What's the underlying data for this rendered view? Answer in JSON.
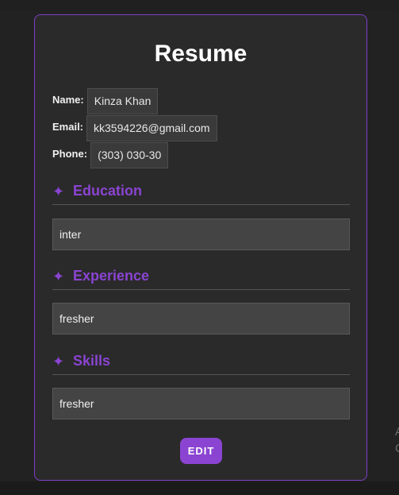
{
  "resume": {
    "title": "Resume",
    "name_label": "Name:",
    "name_value": "Kinza Khan",
    "email_label": "Email:",
    "email_value": "kk3594226@gmail.com",
    "phone_label": "Phone:",
    "phone_value": "(303) 030-30",
    "section_icon_glyph": "✦",
    "education_title": "Education",
    "education_value": "inter",
    "experience_title": "Experience",
    "experience_value": "fresher",
    "skills_title": "Skills",
    "skills_value": "fresher",
    "edit_label": "EDIT"
  },
  "edge": {
    "line1": "A",
    "line2": "C"
  },
  "colors": {
    "accent": "#8a44d1",
    "card_border": "#7d3fc6",
    "background": "#222222",
    "card_background": "#2a2a2a",
    "field_background": "#444444"
  },
  "icons": {
    "section_icon": "sparkle-icon"
  }
}
